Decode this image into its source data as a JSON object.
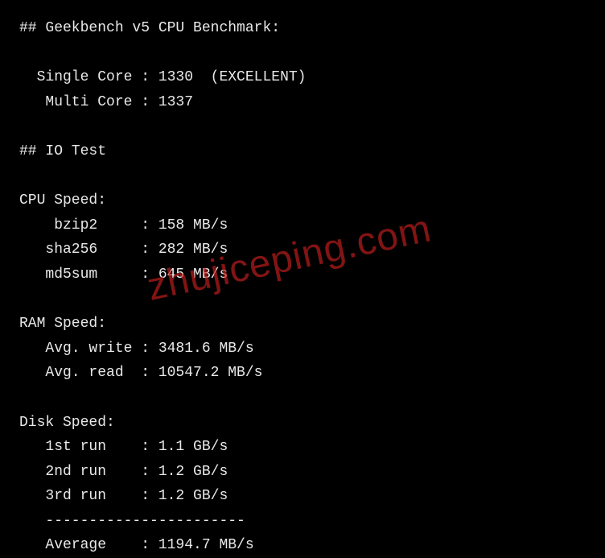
{
  "benchmark": {
    "header": "## Geekbench v5 CPU Benchmark:",
    "single_core_label": "  Single Core : ",
    "single_core_value": "1330",
    "single_core_rating": "  (EXCELLENT)",
    "multi_core_label": "   Multi Core : ",
    "multi_core_value": "1337"
  },
  "io_test": {
    "header": "## IO Test"
  },
  "cpu_speed": {
    "header": "CPU Speed:",
    "bzip2_label": "    bzip2     : ",
    "bzip2_value": "158 MB/s",
    "sha256_label": "   sha256     : ",
    "sha256_value": "282 MB/s",
    "md5sum_label": "   md5sum     : ",
    "md5sum_value": "645 MB/s"
  },
  "ram_speed": {
    "header": "RAM Speed:",
    "write_label": "   Avg. write : ",
    "write_value": "3481.6 MB/s",
    "read_label": "   Avg. read  : ",
    "read_value": "10547.2 MB/s"
  },
  "disk_speed": {
    "header": "Disk Speed:",
    "run1_label": "   1st run    : ",
    "run1_value": "1.1 GB/s",
    "run2_label": "   2nd run    : ",
    "run2_value": "1.2 GB/s",
    "run3_label": "   3rd run    : ",
    "run3_value": "1.2 GB/s",
    "divider": "   -----------------------",
    "avg_label": "   Average    : ",
    "avg_value": "1194.7 MB/s"
  },
  "watermark": "zhujiceping.com"
}
